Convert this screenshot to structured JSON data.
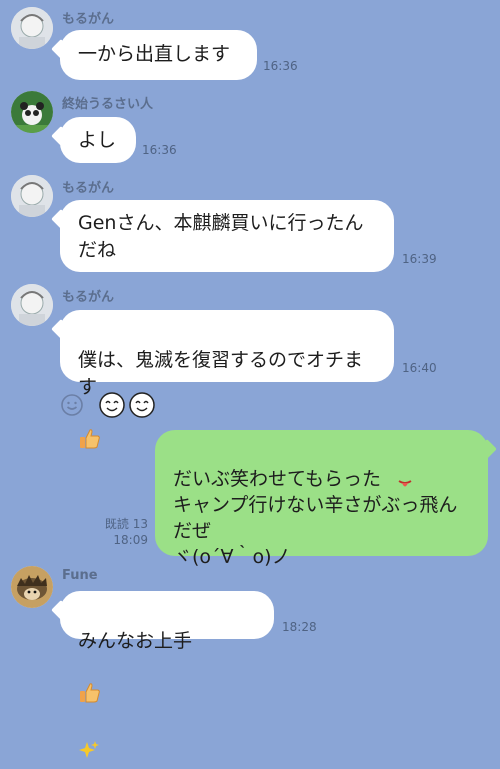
{
  "messages": [
    {
      "sender": "もるがん",
      "text": "一から出直します",
      "time": "16:36"
    },
    {
      "sender": "終始うるさい人",
      "text": "よし",
      "time": "16:36"
    },
    {
      "sender": "もるがん",
      "text": "Genさん、本麒麟買いに行ったん\nだね",
      "time": "16:39"
    },
    {
      "sender": "もるがん",
      "text": "僕は、鬼滅を復習するのでオチま\nす",
      "time": "16:40"
    },
    {
      "own": true,
      "text": "だいぶ笑わせてもらった\nキャンプ行けない辛さがぶっ飛ん\nだぜ\nヾ(o´∀｀o)ノ",
      "read": "既読 13",
      "time": "18:09"
    },
    {
      "sender": "Fune",
      "text": "みんなお上手",
      "time": "18:28"
    }
  ],
  "icons": {
    "reaction": "smiley-reaction-icon",
    "thumbs": "thumbs-up-emoji",
    "sparkle": "sparkle-emoji",
    "tongue": "tongue-emoji"
  },
  "colors": {
    "background": "#8aa5d6",
    "bubble_other": "#ffffff",
    "bubble_own": "#9be087"
  }
}
